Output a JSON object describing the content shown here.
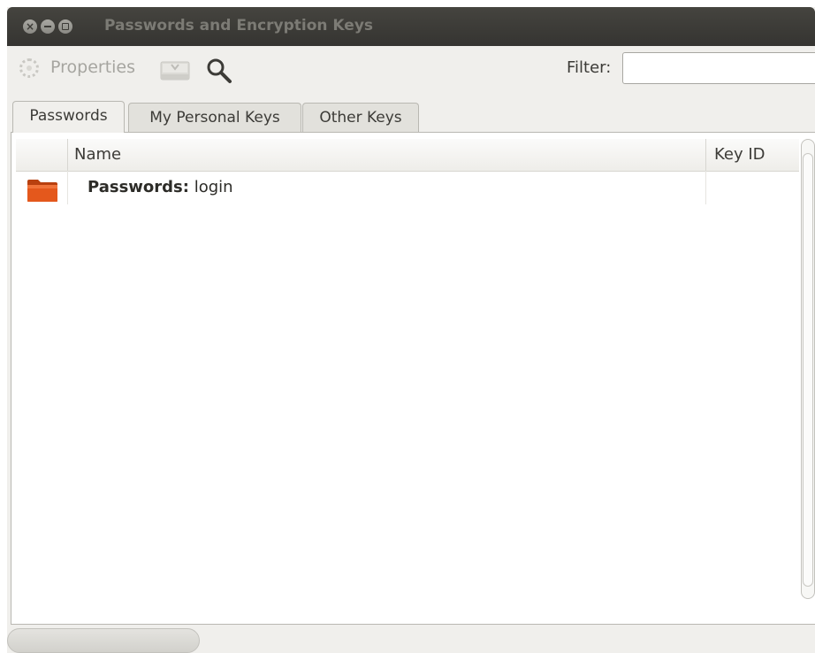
{
  "window": {
    "title": "Passwords and Encryption Keys"
  },
  "toolbar": {
    "properties_label": "Properties",
    "filter_label": "Filter:",
    "filter_value": ""
  },
  "tabs": [
    {
      "label": "Passwords",
      "active": true
    },
    {
      "label": "My Personal Keys",
      "active": false
    },
    {
      "label": "Other Keys",
      "active": false
    }
  ],
  "table": {
    "columns": [
      "Name",
      "Key ID"
    ],
    "rows": [
      {
        "icon": "folder-icon",
        "name_prefix": "Passwords:",
        "name": "login",
        "key_id": ""
      }
    ]
  },
  "colors": {
    "titlebar": "#3c3b37",
    "folder": "#e05a1d",
    "background": "#f0efec"
  }
}
